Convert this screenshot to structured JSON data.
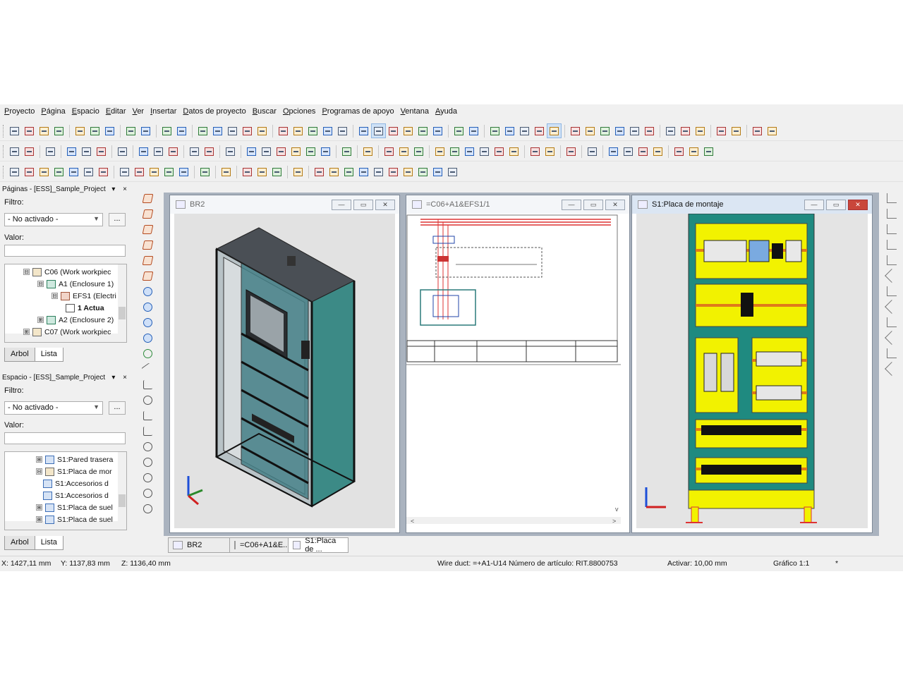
{
  "menu": [
    "Proyecto",
    "Página",
    "Espacio",
    "Editar",
    "Ver",
    "Insertar",
    "Datos de proyecto",
    "Buscar",
    "Opciones",
    "Programas de apoyo",
    "Ventana",
    "Ayuda"
  ],
  "pages_panel": {
    "title": "Páginas - [ESS]_Sample_Project",
    "controls": "▾ ×",
    "filter_label": "Filtro:",
    "filter_value": "- No activado -",
    "more_label": "...",
    "value_label": "Valor:",
    "tree": [
      {
        "exp": "⊟",
        "icon": "fn",
        "label": "C06 (Work workpiec"
      },
      {
        "exp": "⊟",
        "icon": "en",
        "label": "A1 (Enclosure 1)"
      },
      {
        "exp": "⊟",
        "icon": "ef",
        "label": "EFS1 (Electri"
      },
      {
        "exp": "",
        "icon": "pg",
        "label": "1 Actua"
      },
      {
        "exp": "⊞",
        "icon": "en",
        "label": "A2 (Enclosure 2)"
      },
      {
        "exp": "⊞",
        "icon": "fn",
        "label": "C07 (Work workpiec"
      }
    ],
    "tabs": [
      "Arbol",
      "Lista"
    ]
  },
  "space_panel": {
    "title": "Espacio - [ESS]_Sample_Project",
    "controls": "▾ ×",
    "filter_label": "Filtro:",
    "filter_value": "- No activado -",
    "more_label": "...",
    "value_label": "Valor:",
    "tree": [
      {
        "exp": "⊞",
        "icon": "sp",
        "label": "S1:Pared trasera"
      },
      {
        "exp": "⊟",
        "icon": "fn",
        "label": "S1:Placa de mor"
      },
      {
        "exp": "",
        "icon": "sp",
        "label": "S1:Accesorios d"
      },
      {
        "exp": "",
        "icon": "sp",
        "label": "S1:Accesorios d"
      },
      {
        "exp": "⊞",
        "icon": "sp",
        "label": "S1:Placa de suel"
      },
      {
        "exp": "⊞",
        "icon": "sp",
        "label": "S1:Placa de suel"
      }
    ],
    "tabs": [
      "Arbol",
      "Lista"
    ]
  },
  "windows": {
    "w1_title": "BR2",
    "w2_title": "=C06+A1&EFS1/1",
    "w3_title": "S1:Placa de montaje",
    "min": "—",
    "max": "▭",
    "close": "✕"
  },
  "doc_tabs": [
    "BR2",
    "=C06+A1&E...",
    "S1:Placa de ..."
  ],
  "status": {
    "x": "X: 1427,11 mm",
    "y": "Y: 1137,83 mm",
    "z": "Z: 1136,40 mm",
    "info": "Wire duct: =+A1-U14 Número de artículo: RIT.8800753",
    "snap": "Activar: 10,00 mm",
    "scale": "Gráfico 1:1",
    "mark": "*"
  }
}
